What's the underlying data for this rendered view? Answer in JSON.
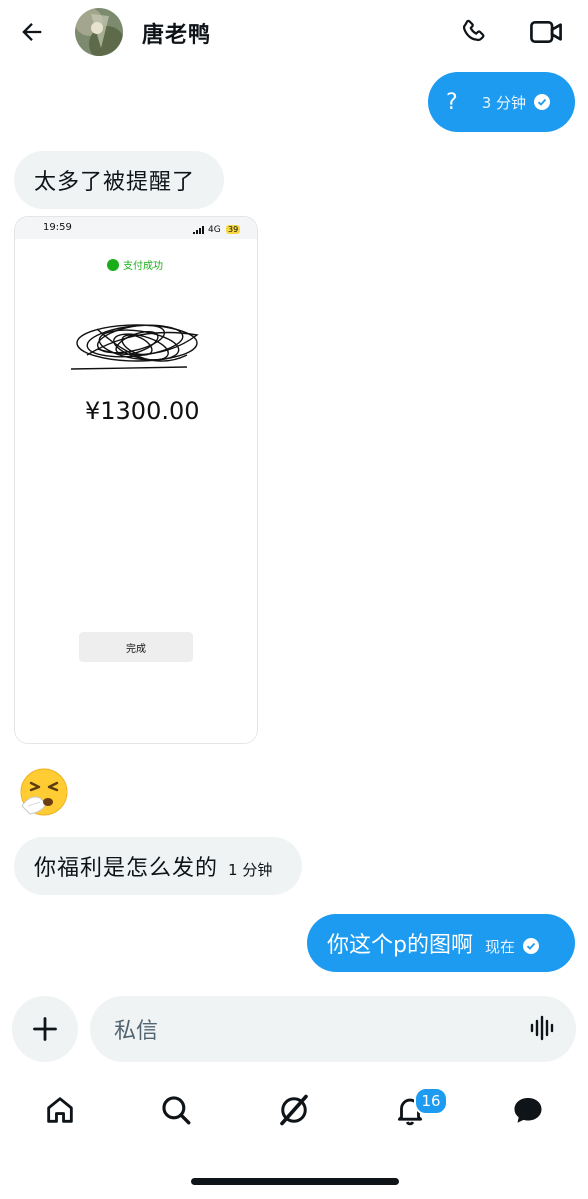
{
  "header": {
    "title": "唐老鸭",
    "back_icon": "arrow-left-icon",
    "call_icon": "phone-icon",
    "video_icon": "video-camera-icon"
  },
  "messages": [
    {
      "direction": "out",
      "text": "?",
      "time": "3 分钟",
      "read": true
    },
    {
      "direction": "in",
      "text": "太多了被提醒了"
    },
    {
      "direction": "in",
      "type": "image",
      "screenshot": {
        "time": "19:59",
        "network": "4G",
        "battery": "39",
        "status": "支付成功",
        "amount": "¥1300.00",
        "button": "完成"
      }
    },
    {
      "direction": "in",
      "type": "emoji",
      "emoji": "sneezing-face"
    },
    {
      "direction": "in",
      "text": "你福利是怎么发的",
      "time": "1 分钟"
    },
    {
      "direction": "out",
      "text": "你这个p的图啊",
      "time": "现在",
      "read": true
    }
  ],
  "composer": {
    "placeholder": "私信",
    "add_icon": "plus-icon",
    "voice_icon": "audio-wave-icon"
  },
  "tabbar": {
    "items": [
      "home-icon",
      "search-icon",
      "grok-icon",
      "bell-icon",
      "messages-icon"
    ],
    "notifications_count": "16"
  },
  "colors": {
    "accent": "#1d9bf0",
    "bubble_in": "#eff3f4",
    "text": "#0f1419"
  }
}
